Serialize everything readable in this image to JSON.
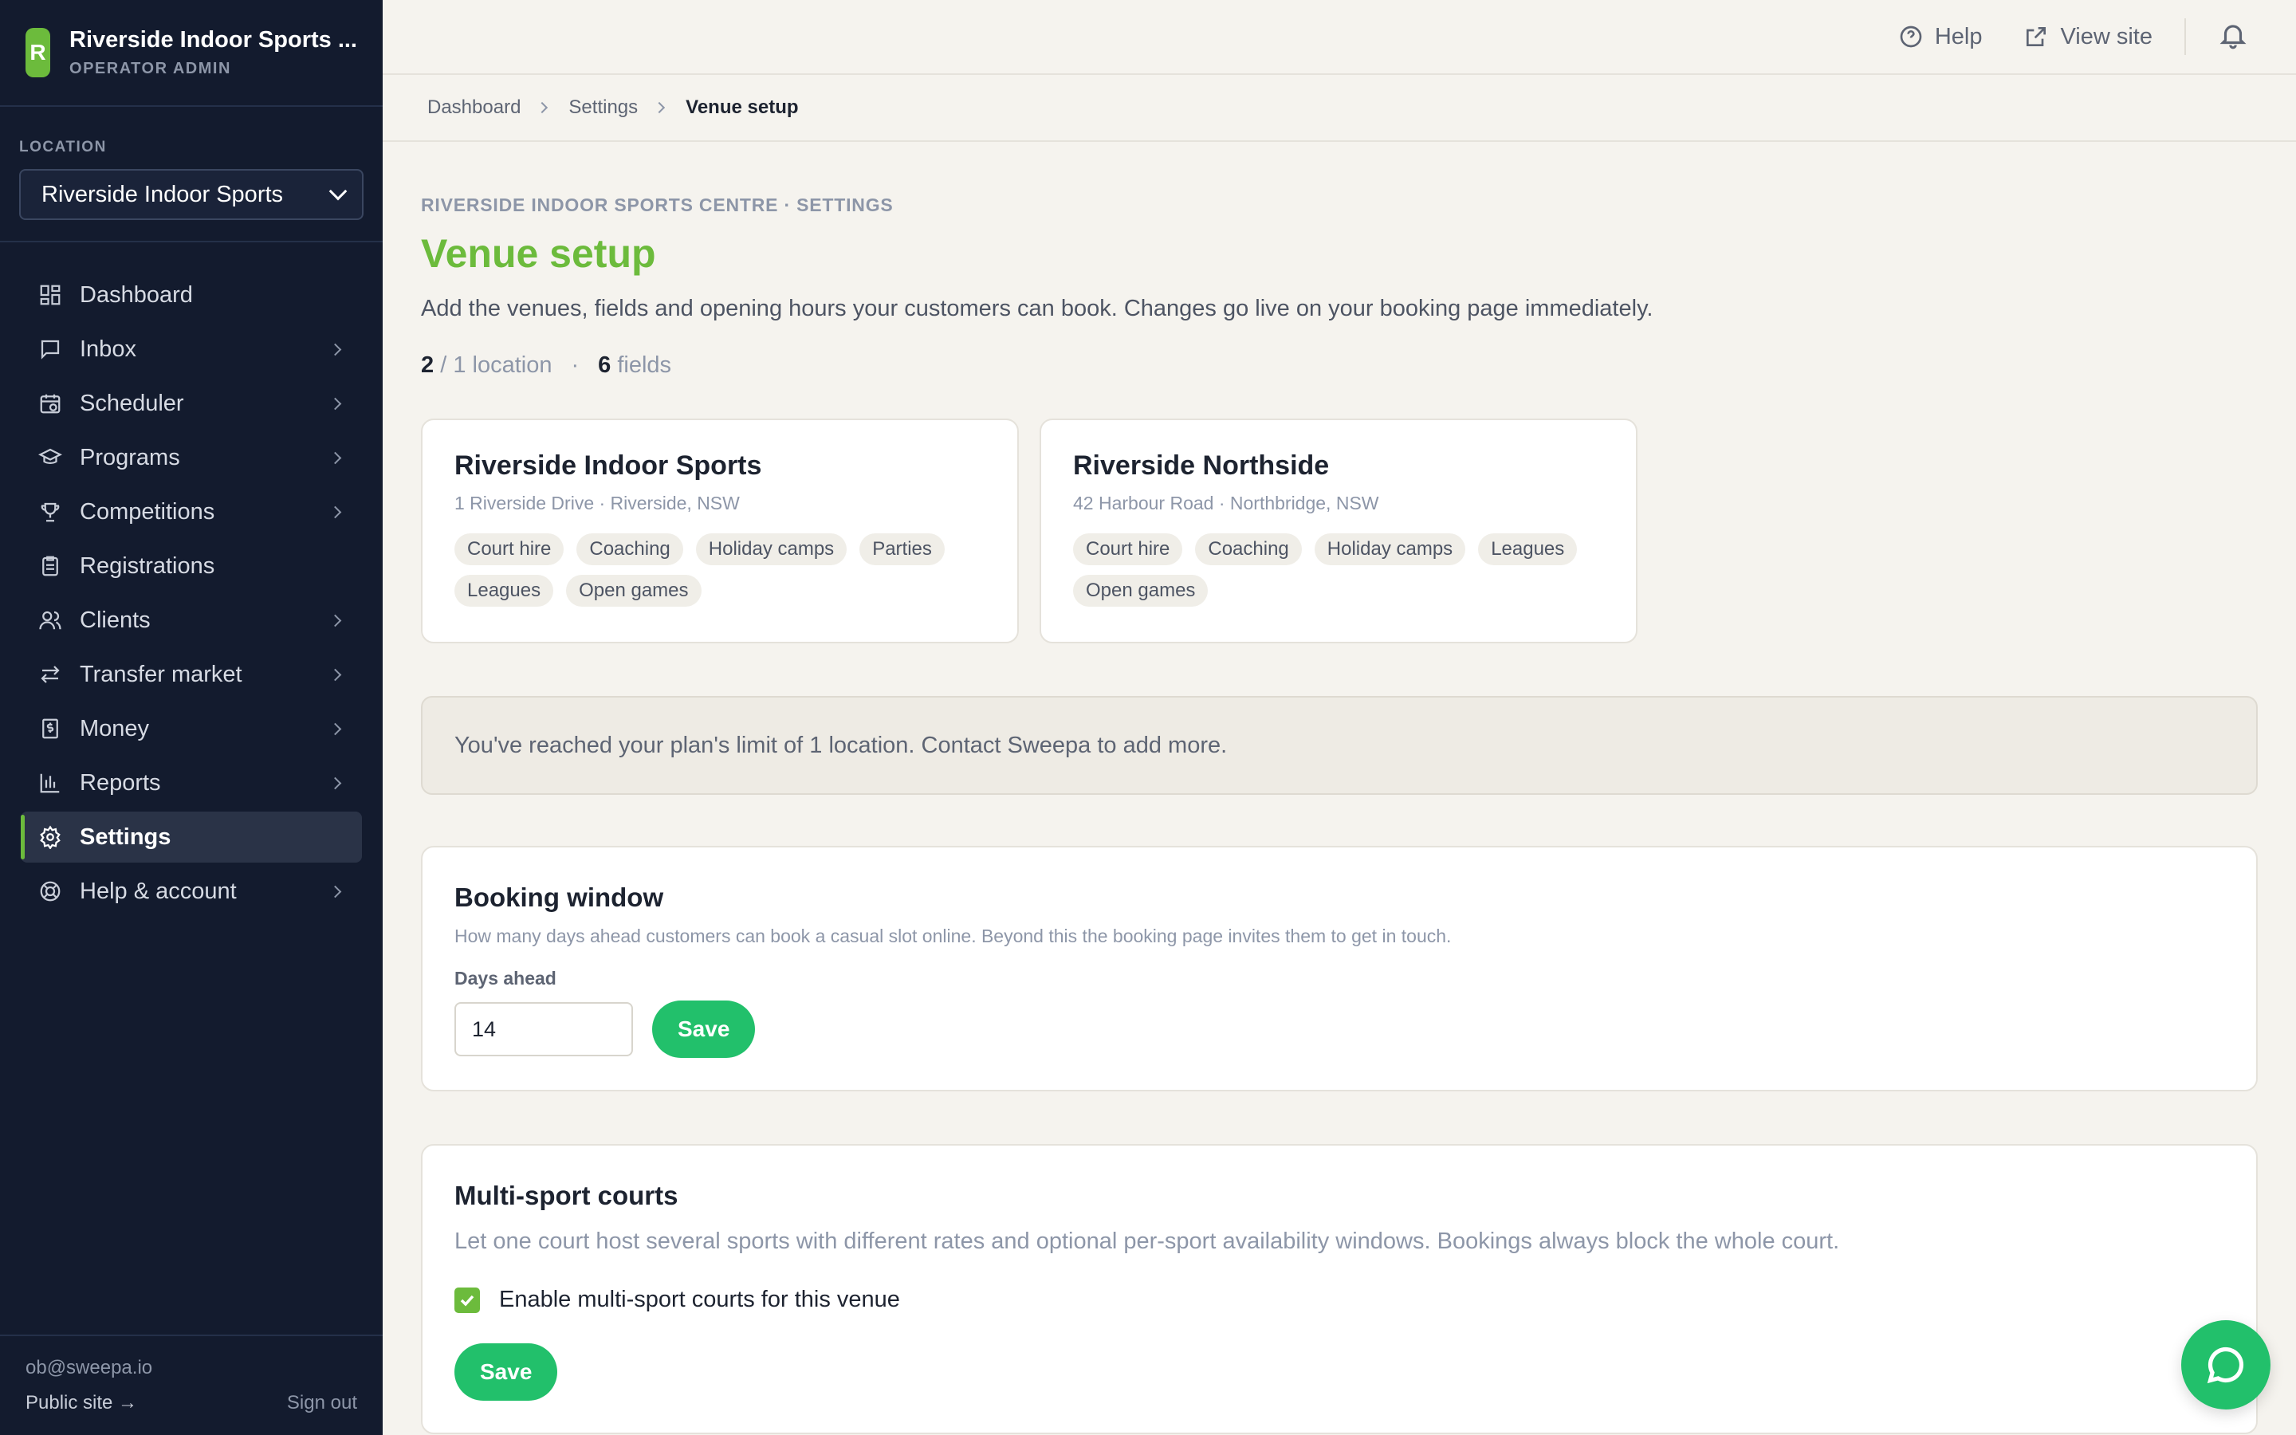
{
  "brand": {
    "initial": "R",
    "name": "Riverside Indoor Sports ...",
    "role": "OPERATOR ADMIN"
  },
  "location": {
    "label": "LOCATION",
    "selected": "Riverside Indoor Sports"
  },
  "nav": {
    "items": [
      {
        "label": "Dashboard",
        "icon": "dashboard-icon",
        "has_children": false,
        "active": false
      },
      {
        "label": "Inbox",
        "icon": "inbox-icon",
        "has_children": true,
        "active": false
      },
      {
        "label": "Scheduler",
        "icon": "calendar-icon",
        "has_children": true,
        "active": false
      },
      {
        "label": "Programs",
        "icon": "graduation-cap-icon",
        "has_children": true,
        "active": false
      },
      {
        "label": "Competitions",
        "icon": "trophy-icon",
        "has_children": true,
        "active": false
      },
      {
        "label": "Registrations",
        "icon": "clipboard-icon",
        "has_children": false,
        "active": false
      },
      {
        "label": "Clients",
        "icon": "users-icon",
        "has_children": true,
        "active": false
      },
      {
        "label": "Transfer market",
        "icon": "transfer-icon",
        "has_children": true,
        "active": false
      },
      {
        "label": "Money",
        "icon": "receipt-icon",
        "has_children": true,
        "active": false
      },
      {
        "label": "Reports",
        "icon": "bar-chart-icon",
        "has_children": true,
        "active": false
      },
      {
        "label": "Settings",
        "icon": "gear-icon",
        "has_children": false,
        "active": true
      },
      {
        "label": "Help & account",
        "icon": "lifebuoy-icon",
        "has_children": true,
        "active": false
      }
    ]
  },
  "footer": {
    "email": "ob@sweepa.io",
    "public_site": "Public site →",
    "sign_out": "Sign out"
  },
  "topbar": {
    "help": "Help",
    "view_site": "View site"
  },
  "breadcrumb": {
    "items": [
      "Dashboard",
      "Settings"
    ],
    "current": "Venue setup"
  },
  "page": {
    "eyebrow": "RIVERSIDE INDOOR SPORTS CENTRE · SETTINGS",
    "title": "Venue setup",
    "description": "Add the venues, fields and opening hours your customers can book. Changes go live on your booking page immediately.",
    "stats": {
      "locations_count": "2",
      "locations_suffix": "/ 1 location",
      "separator": "·",
      "fields_count": "6",
      "fields_suffix": "fields"
    }
  },
  "venues": [
    {
      "name": "Riverside Indoor Sports",
      "address": "1 Riverside Drive · Riverside, NSW",
      "tags": [
        "Court hire",
        "Coaching",
        "Holiday camps",
        "Parties",
        "Leagues",
        "Open games"
      ]
    },
    {
      "name": "Riverside Northside",
      "address": "42 Harbour Road · Northbridge, NSW",
      "tags": [
        "Court hire",
        "Coaching",
        "Holiday camps",
        "Leagues",
        "Open games"
      ]
    }
  ],
  "limit_notice": "You've reached your plan's limit of 1 location. Contact Sweepa to add more.",
  "booking_window": {
    "title": "Booking window",
    "description": "How many days ahead customers can book a casual slot online. Beyond this the booking page invites them to get in touch.",
    "field_label": "Days ahead",
    "value": "14",
    "save_label": "Save"
  },
  "multi_sport": {
    "title": "Multi-sport courts",
    "description": "Let one court host several sports with different rates and optional per-sport availability windows. Bookings always block the whole court.",
    "checkbox_label": "Enable multi-sport courts for this venue",
    "checked": true,
    "save_label": "Save"
  },
  "colors": {
    "accent": "#6cbb3c",
    "button": "#22c06b",
    "sidebar": "#131b2e"
  }
}
